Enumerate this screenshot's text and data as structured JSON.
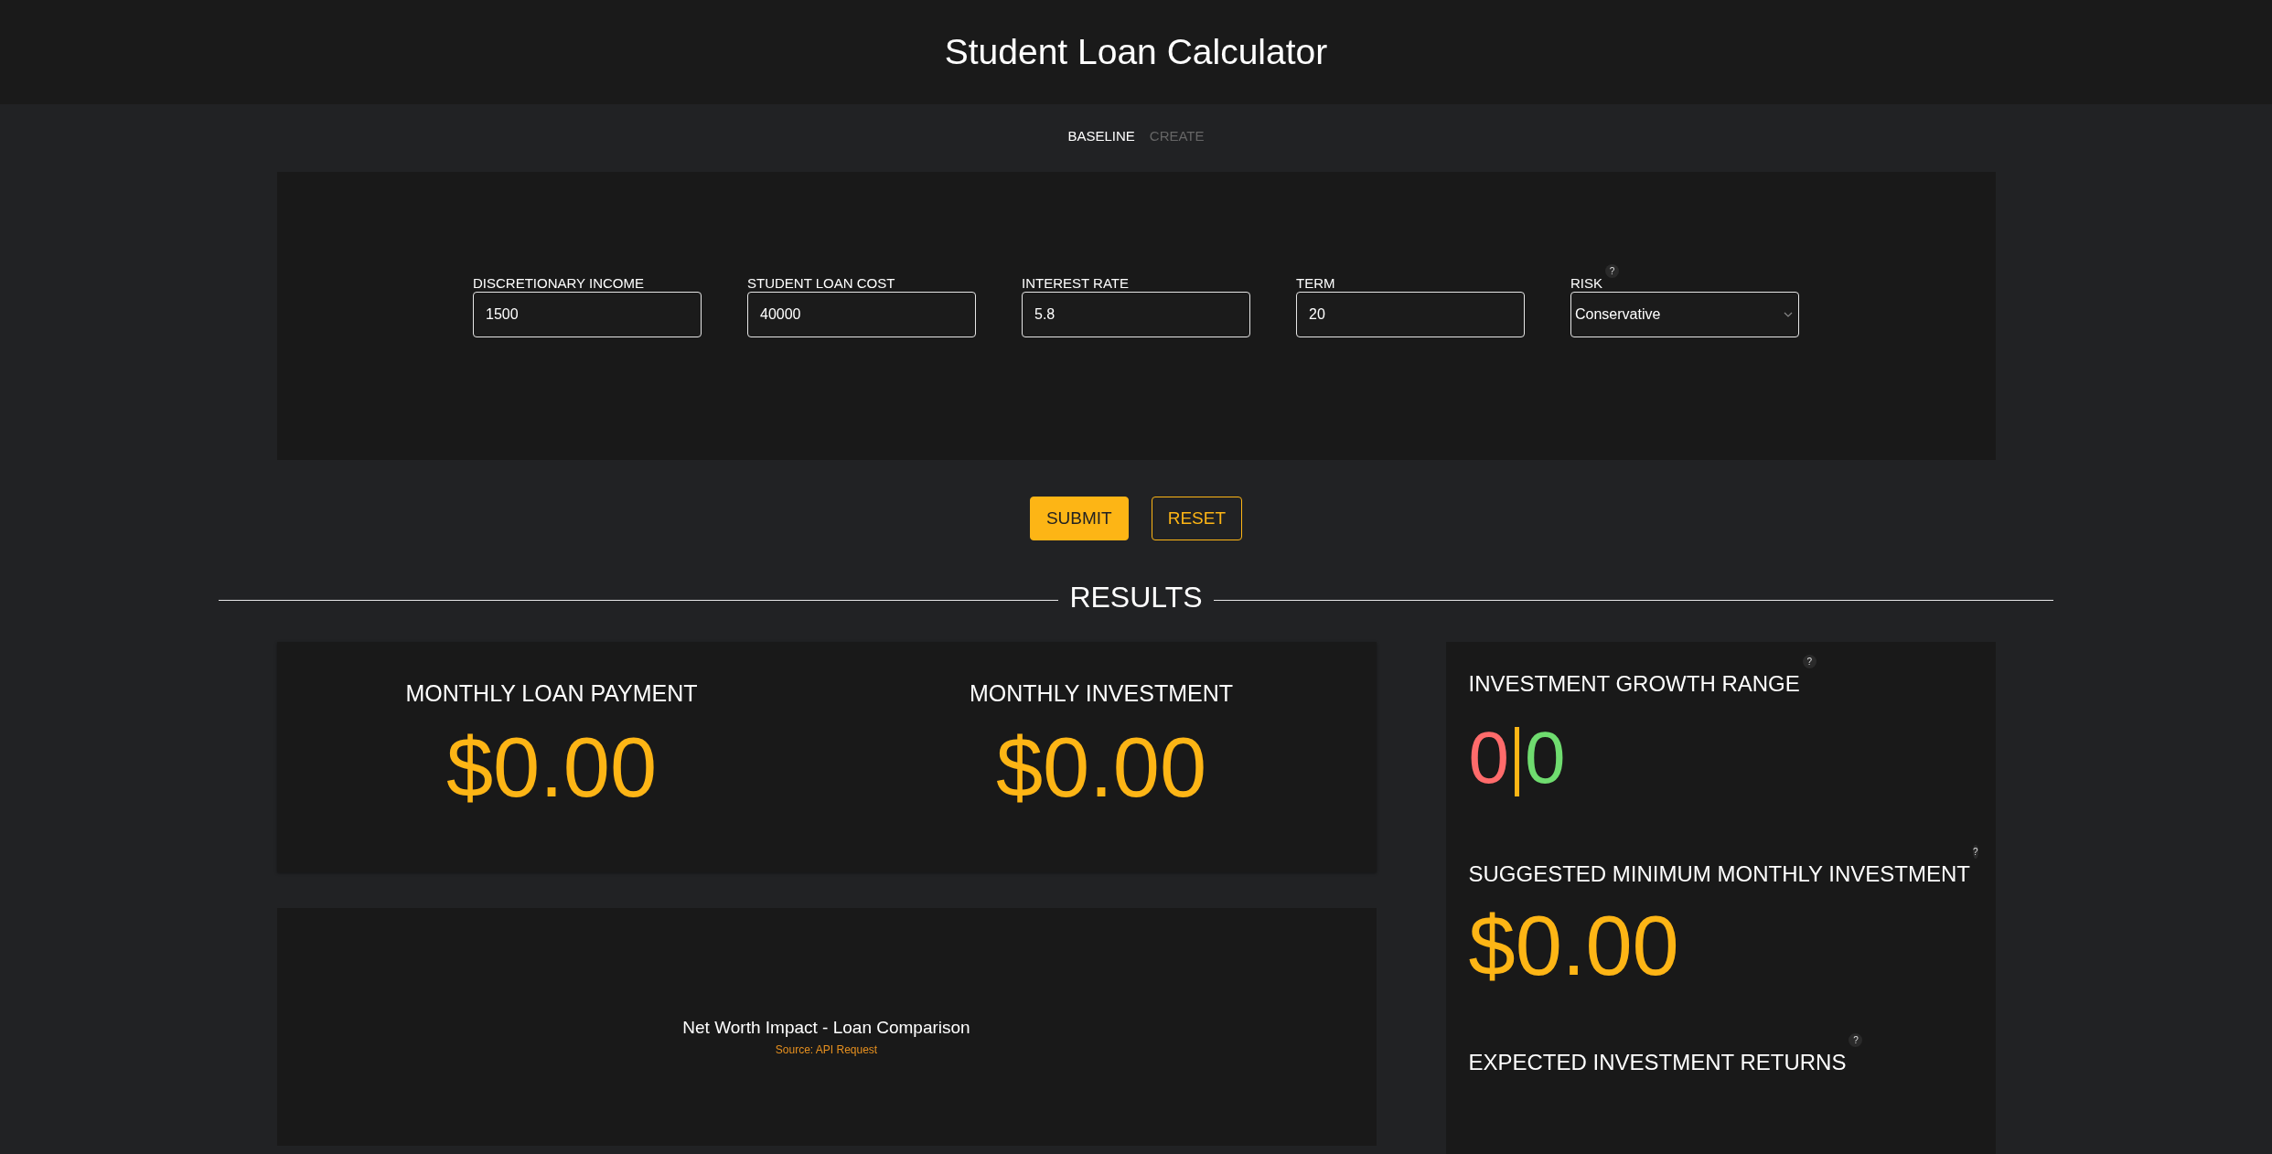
{
  "header": {
    "title": "Student Loan Calculator"
  },
  "tabs": [
    {
      "label": "BASELINE",
      "selected": true
    },
    {
      "label": "CREATE",
      "selected": false
    }
  ],
  "form": {
    "fields": [
      {
        "kind": "input",
        "label": "DISCRETIONARY INCOME",
        "value": "1500"
      },
      {
        "kind": "input",
        "label": "STUDENT LOAN COST",
        "value": "40000"
      },
      {
        "kind": "input",
        "label": "INTEREST RATE",
        "value": "5.8"
      },
      {
        "kind": "input",
        "label": "TERM",
        "value": "20"
      },
      {
        "kind": "select",
        "label": "RISK",
        "value": "Conservative",
        "help": "?"
      }
    ]
  },
  "buttons": [
    {
      "kind": "primary",
      "label": "SUBMIT"
    },
    {
      "kind": "outline",
      "label": "RESET"
    }
  ],
  "results": {
    "heading": "RESULTS",
    "summary": [
      {
        "label": "MONTHLY LOAN PAYMENT",
        "value": "$0.00"
      },
      {
        "label": "MONTHLY INVESTMENT",
        "value": "$0.00"
      }
    ],
    "chart": {
      "title": "Net Worth Impact - Loan Comparison",
      "source": "Source: API Request"
    },
    "side": [
      {
        "kind": "range",
        "label": "INVESTMENT GROWTH RANGE",
        "help": "?",
        "low": "0",
        "high": "0"
      },
      {
        "kind": "amount",
        "label": "SUGGESTED MINIMUM MONTHLY INVESTMENT",
        "help": "?",
        "value": "$0.00"
      },
      {
        "kind": "amount",
        "label": "EXPECTED INVESTMENT RETURNS",
        "help": "?"
      }
    ]
  }
}
